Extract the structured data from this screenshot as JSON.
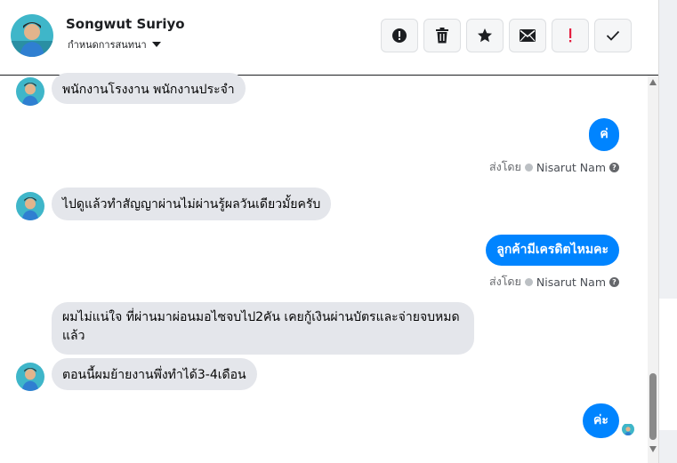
{
  "contact": {
    "name": "Songwut Suriyo",
    "subtitle": "กำหนดการสนทนา"
  },
  "toolbar": {
    "buttons": [
      {
        "name": "report",
        "icon": "alert-circle-icon"
      },
      {
        "name": "delete",
        "icon": "trash-icon"
      },
      {
        "name": "star",
        "icon": "star-icon"
      },
      {
        "name": "mail",
        "icon": "envelope-icon"
      },
      {
        "name": "important",
        "icon": "exclamation-icon",
        "color": "#e41e3f"
      },
      {
        "name": "done",
        "icon": "check-icon"
      }
    ]
  },
  "messages": [
    {
      "from": "in",
      "text": "พนักงานโรงงาน พนักงานประจำ"
    },
    {
      "from": "out",
      "text": "ค่",
      "sent_by_label": "ส่งโดย",
      "sender": "Nisarut Nam"
    },
    {
      "from": "in",
      "text": "ไปดูแล้วทำสัญญาผ่านไม่ผ่านรู้ผลวันเดียวมั้ยครับ"
    },
    {
      "from": "out",
      "text": "ลูกค้ามีเครดิตไหมคะ",
      "sent_by_label": "ส่งโดย",
      "sender": "Nisarut Nam"
    },
    {
      "from": "in",
      "text": "ผมไม่แน่ใจ ที่ผ่านมาผ่อนมอไซจบไป2คัน เคยกู้เงินผ่านบัตรและจ่ายจบหมดแล้ว"
    },
    {
      "from": "in",
      "text": "ตอนนี้ผมย้ายงานพึ่งทำได้3-4เดือน"
    },
    {
      "from": "out",
      "text": "ค่ะ"
    }
  ],
  "colors": {
    "outgoing_bubble": "#0084ff",
    "incoming_bubble": "#e4e6eb"
  }
}
